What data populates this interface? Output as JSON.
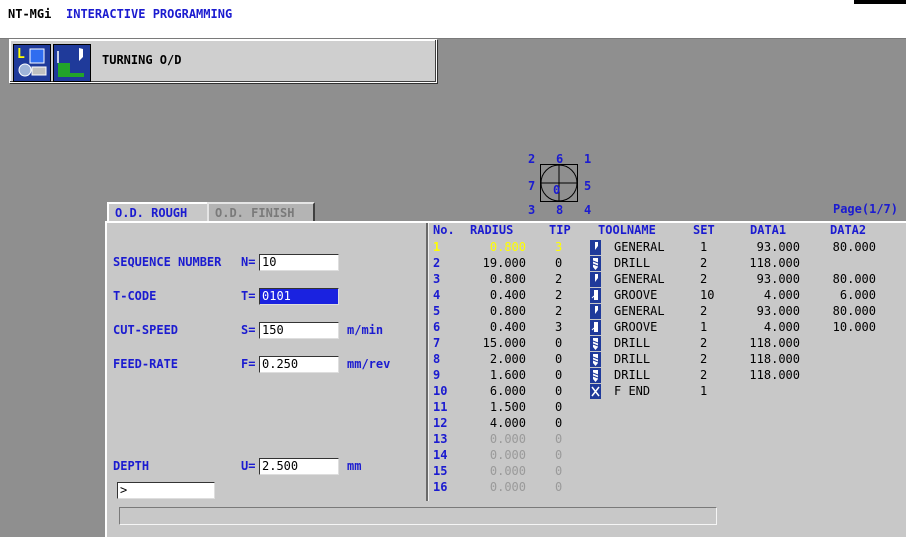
{
  "titlebar": {
    "brand": "NT-MGi",
    "title": "INTERACTIVE PROGRAMMING"
  },
  "mode": {
    "label": "TURNING O/D",
    "icons": [
      "lathe-icon",
      "turning-od-icon"
    ],
    "icon_letter": "L"
  },
  "tip_diagram": {
    "labels": [
      "2",
      "6",
      "1",
      "7",
      "0",
      "5",
      "3",
      "8",
      "4"
    ]
  },
  "tabs": [
    {
      "label": "O.D. ROUGH",
      "active": true
    },
    {
      "label": "O.D. FINISH",
      "active": false
    }
  ],
  "page_label": "Page(1/7)",
  "fields": {
    "sequence": {
      "label": "SEQUENCE NUMBER",
      "letter": "N=",
      "value": "10",
      "unit": ""
    },
    "tcode": {
      "label": "T-CODE",
      "letter": "T=",
      "value": "0101",
      "unit": ""
    },
    "cutspeed": {
      "label": "CUT-SPEED",
      "letter": "S=",
      "value": "150",
      "unit": "m/min"
    },
    "feedrate": {
      "label": "FEED-RATE",
      "letter": "F=",
      "value": "0.250",
      "unit": "mm/rev"
    },
    "depth": {
      "label": "DEPTH",
      "letter": "U=",
      "value": "2.500",
      "unit": "mm"
    }
  },
  "command_line": ">",
  "table": {
    "headers": {
      "no": "No.",
      "radius": "RADIUS",
      "tip": "TIP",
      "toolname": "TOOLNAME",
      "set": "SET",
      "data1": "DATA1",
      "data2": "DATA2"
    },
    "rows": [
      {
        "no": "1",
        "radius": "0.800",
        "tip": "3",
        "icon": "general-tool-icon",
        "name": "GENERAL",
        "set": "1",
        "data1": "93.000",
        "data2": "80.000",
        "highlight": true
      },
      {
        "no": "2",
        "radius": "19.000",
        "tip": "0",
        "icon": "drill-tool-icon",
        "name": "DRILL",
        "set": "2",
        "data1": "118.000",
        "data2": ""
      },
      {
        "no": "3",
        "radius": "0.800",
        "tip": "2",
        "icon": "general-tool-icon",
        "name": "GENERAL",
        "set": "2",
        "data1": "93.000",
        "data2": "80.000"
      },
      {
        "no": "4",
        "radius": "0.400",
        "tip": "2",
        "icon": "groove-tool-icon",
        "name": "GROOVE",
        "set": "10",
        "data1": "4.000",
        "data2": "6.000"
      },
      {
        "no": "5",
        "radius": "0.800",
        "tip": "2",
        "icon": "general-tool-icon",
        "name": "GENERAL",
        "set": "2",
        "data1": "93.000",
        "data2": "80.000"
      },
      {
        "no": "6",
        "radius": "0.400",
        "tip": "3",
        "icon": "groove-tool-icon",
        "name": "GROOVE",
        "set": "1",
        "data1": "4.000",
        "data2": "10.000"
      },
      {
        "no": "7",
        "radius": "15.000",
        "tip": "0",
        "icon": "drill-tool-icon",
        "name": "DRILL",
        "set": "2",
        "data1": "118.000",
        "data2": ""
      },
      {
        "no": "8",
        "radius": "2.000",
        "tip": "0",
        "icon": "drill-tool-icon",
        "name": "DRILL",
        "set": "2",
        "data1": "118.000",
        "data2": ""
      },
      {
        "no": "9",
        "radius": "1.600",
        "tip": "0",
        "icon": "drill-tool-icon",
        "name": "DRILL",
        "set": "2",
        "data1": "118.000",
        "data2": ""
      },
      {
        "no": "10",
        "radius": "6.000",
        "tip": "0",
        "icon": "end-icon",
        "name": "F END",
        "set": "1",
        "data1": "",
        "data2": ""
      },
      {
        "no": "11",
        "radius": "1.500",
        "tip": "0",
        "icon": "",
        "name": "",
        "set": "",
        "data1": "",
        "data2": ""
      },
      {
        "no": "12",
        "radius": "4.000",
        "tip": "0",
        "icon": "",
        "name": "",
        "set": "",
        "data1": "",
        "data2": ""
      },
      {
        "no": "13",
        "radius": "0.000",
        "tip": "0",
        "icon": "",
        "name": "",
        "set": "",
        "data1": "",
        "data2": "",
        "empty": true
      },
      {
        "no": "14",
        "radius": "0.000",
        "tip": "0",
        "icon": "",
        "name": "",
        "set": "",
        "data1": "",
        "data2": "",
        "empty": true
      },
      {
        "no": "15",
        "radius": "0.000",
        "tip": "0",
        "icon": "",
        "name": "",
        "set": "",
        "data1": "",
        "data2": "",
        "empty": true
      },
      {
        "no": "16",
        "radius": "0.000",
        "tip": "0",
        "icon": "",
        "name": "",
        "set": "",
        "data1": "",
        "data2": "",
        "empty": true
      }
    ]
  },
  "colors": {
    "accent_blue": "#1b1bd0",
    "panel_gray": "#c8c8c8",
    "highlight_yellow": "#ffff00",
    "selection_blue": "#1a22e0"
  }
}
